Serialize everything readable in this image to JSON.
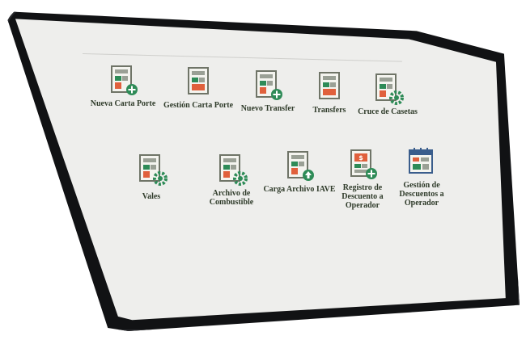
{
  "apps": [
    {
      "label": "Nueva Carta Porte",
      "icon": "document-plus-icon"
    },
    {
      "label": "Gestión Carta Porte",
      "icon": "document-icon"
    },
    {
      "label": "Nuevo Transfer",
      "icon": "document-plus-icon"
    },
    {
      "label": "Transfers",
      "icon": "document-icon"
    },
    {
      "label": "Cruce de Casetas",
      "icon": "document-gear-icon"
    },
    {
      "label": "Vales",
      "icon": "document-gear-icon"
    },
    {
      "label": "Archivo de Combustible",
      "icon": "document-gear-icon"
    },
    {
      "label": "Carga Archivo IAVE",
      "icon": "document-upload-icon"
    },
    {
      "label": "Registro de Descuento a Operador",
      "icon": "document-discount-plus-icon"
    },
    {
      "label": "Gestión de Descuentos a Operador",
      "icon": "calendar-discount-icon"
    }
  ],
  "colors": {
    "bezel": "#111214",
    "screen": "#eeeeec",
    "icon_green": "#2e8b57",
    "icon_orange": "#e0603c",
    "icon_frame": "#6f7467",
    "label_text": "#2f3b2a"
  }
}
